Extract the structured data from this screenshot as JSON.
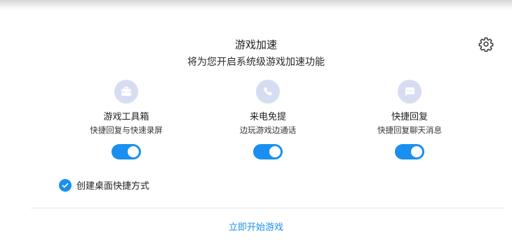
{
  "header": {
    "title": "游戏加速",
    "subtitle": "将为您开启系统级游戏加速功能",
    "settings_icon": "gear-icon"
  },
  "features": [
    {
      "name": "游戏工具箱",
      "desc": "快捷回复与快速录屏",
      "icon": "toolbox-icon",
      "enabled": true
    },
    {
      "name": "来电免提",
      "desc": "边玩游戏边通话",
      "icon": "phone-icon",
      "enabled": true
    },
    {
      "name": "快捷回复",
      "desc": "快捷回复聊天消息",
      "icon": "chat-bubble-icon",
      "enabled": true
    }
  ],
  "shortcut": {
    "label": "创建桌面快捷方式",
    "checked": true
  },
  "start_button": {
    "label": "立即开始游戏"
  },
  "colors": {
    "accent": "#1a8ff0",
    "icon_bg": "#d7ddf1",
    "icon_fg": "#ffffff"
  }
}
